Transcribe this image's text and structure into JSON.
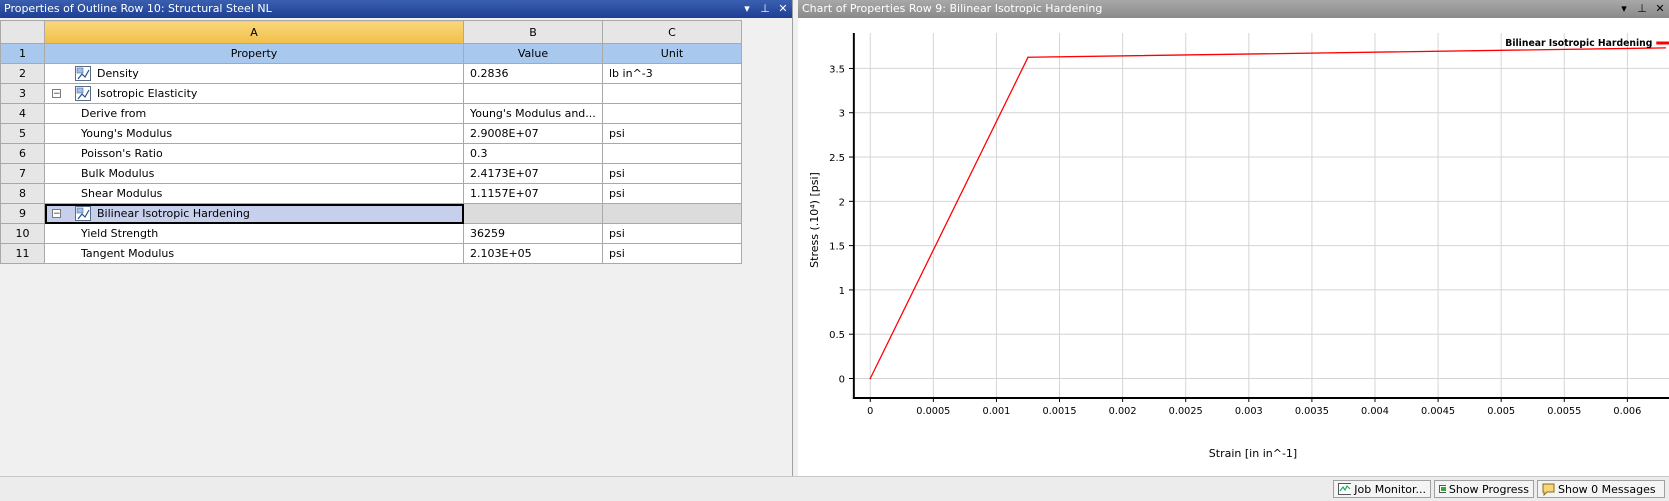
{
  "left_panel": {
    "title": "Properties of Outline Row 10: Structural Steel NL",
    "columns": [
      "A",
      "B",
      "C"
    ],
    "header_row": {
      "num": "1",
      "property": "Property",
      "value": "Value",
      "unit": "Unit"
    },
    "rows": [
      {
        "num": "2",
        "property": "Density",
        "value": "0.2836",
        "unit": "lb in^-3",
        "level": 0,
        "icon": "material-icon",
        "expander": ""
      },
      {
        "num": "3",
        "property": "Isotropic Elasticity",
        "value": "",
        "unit": "",
        "level": 0,
        "icon": "material-icon",
        "expander": "−"
      },
      {
        "num": "4",
        "property": "Derive from",
        "value": "Young's Modulus and...",
        "unit": "",
        "level": 1
      },
      {
        "num": "5",
        "property": "Young's Modulus",
        "value": "2.9008E+07",
        "unit": "psi",
        "level": 1
      },
      {
        "num": "6",
        "property": "Poisson's Ratio",
        "value": "0.3",
        "unit": "",
        "level": 1
      },
      {
        "num": "7",
        "property": "Bulk Modulus",
        "value": "2.4173E+07",
        "unit": "psi",
        "level": 1
      },
      {
        "num": "8",
        "property": "Shear Modulus",
        "value": "1.1157E+07",
        "unit": "psi",
        "level": 1
      },
      {
        "num": "9",
        "property": "Bilinear Isotropic Hardening",
        "value": "",
        "unit": "",
        "level": 0,
        "icon": "material-icon",
        "expander": "−",
        "selected": true
      },
      {
        "num": "10",
        "property": "Yield Strength",
        "value": "36259",
        "unit": "psi",
        "level": 1
      },
      {
        "num": "11",
        "property": "Tangent Modulus",
        "value": "2.103E+05",
        "unit": "psi",
        "level": 1
      }
    ]
  },
  "right_panel": {
    "title": "Chart of Properties Row 9: Bilinear Isotropic Hardening"
  },
  "window_buttons": {
    "menu": "▾",
    "pin": "⊥",
    "close": "✕"
  },
  "chart_data": {
    "type": "line",
    "title": "",
    "xlabel": "Strain  [in in^-1]",
    "ylabel": "Stress  (.10⁴)  [psi]",
    "xlim": [
      -0.00013,
      0.00643
    ],
    "ylim": [
      -0.22,
      3.9
    ],
    "xticks": [
      0,
      0.0005,
      0.001,
      0.0015,
      0.002,
      0.0025,
      0.003,
      0.0035,
      0.004,
      0.0045,
      0.005,
      0.0055,
      0.006
    ],
    "xtick_labels": [
      "0",
      "0.0005",
      "0.001",
      "0.0015",
      "0.002",
      "0.0025",
      "0.003",
      "0.0035",
      "0.004",
      "0.0045",
      "0.005",
      "0.0055",
      "0.006"
    ],
    "yticks": [
      0,
      0.5,
      1,
      1.5,
      2,
      2.5,
      3,
      3.5
    ],
    "ytick_labels": [
      "0",
      "0.5",
      "1",
      "1.5",
      "2",
      "2.5",
      "3",
      "3.5"
    ],
    "grid": true,
    "legend_position": "top-right",
    "series": [
      {
        "name": "Bilinear Isotropic Hardening",
        "color": "#ff0000",
        "x": [
          0,
          0.00125,
          0.0063
        ],
        "y": [
          0,
          3.6259,
          3.732
        ]
      }
    ]
  },
  "statusbar": {
    "job_monitor": "Job Monitor...",
    "show_progress": "Show Progress",
    "show_messages": "Show 0 Messages"
  }
}
